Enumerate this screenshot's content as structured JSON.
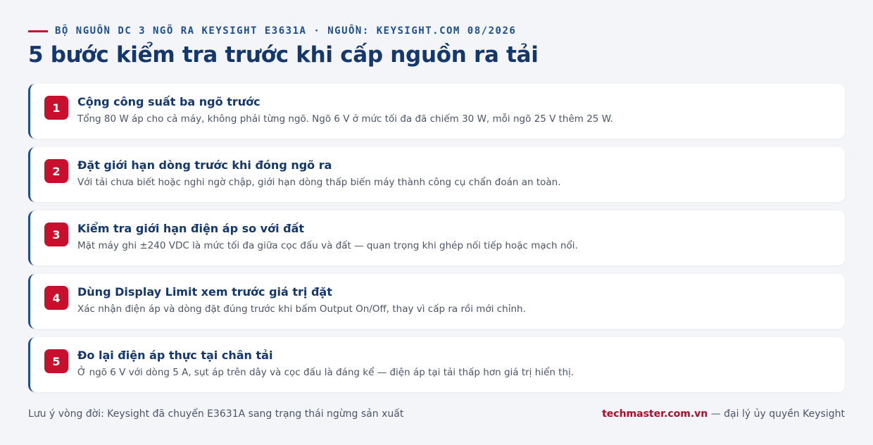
{
  "header": {
    "kicker": "BỘ NGUỒN DC 3 NGÕ RA KEYSIGHT E3631A · NGUỒN: KEYSIGHT.COM 08/2026",
    "title": "5 bước kiểm tra trước khi cấp nguồn ra tải"
  },
  "steps": [
    {
      "number": "1",
      "title": "Cộng công suất ba ngõ trước",
      "desc": "Tổng 80 W áp cho cả máy, không phải từng ngõ. Ngõ 6 V ở mức tối đa đã chiếm 30 W, mỗi ngõ 25 V thêm 25 W."
    },
    {
      "number": "2",
      "title": "Đặt giới hạn dòng trước khi đóng ngõ ra",
      "desc": "Với tải chưa biết hoặc nghi ngờ chập, giới hạn dòng thấp biến máy thành công cụ chẩn đoán an toàn."
    },
    {
      "number": "3",
      "title": "Kiểm tra giới hạn điện áp so với đất",
      "desc": "Mặt máy ghi ±240 VDC là mức tối đa giữa cọc đấu và đất — quan trọng khi ghép nối tiếp hoặc mạch nổi."
    },
    {
      "number": "4",
      "title": "Dùng Display Limit xem trước giá trị đặt",
      "desc": "Xác nhận điện áp và dòng đặt đúng trước khi bấm Output On/Off, thay vì cấp ra rồi mới chỉnh."
    },
    {
      "number": "5",
      "title": "Đo lại điện áp thực tại chân tải",
      "desc": "Ở ngõ 6 V với dòng 5 A, sụt áp trên dây và cọc đấu là đáng kể — điện áp tại tải thấp hơn giá trị hiển thị."
    }
  ],
  "footer": {
    "note": "Lưu ý vòng đời: Keysight đã chuyển E3631A sang trạng thái ngừng sản xuất",
    "brand": "techmaster.com.vn",
    "suffix": " — đại lý ủy quyền Keysight"
  },
  "colors": {
    "accent_red": "#c8102e",
    "navy": "#14386e",
    "background": "#f4f5f9"
  }
}
